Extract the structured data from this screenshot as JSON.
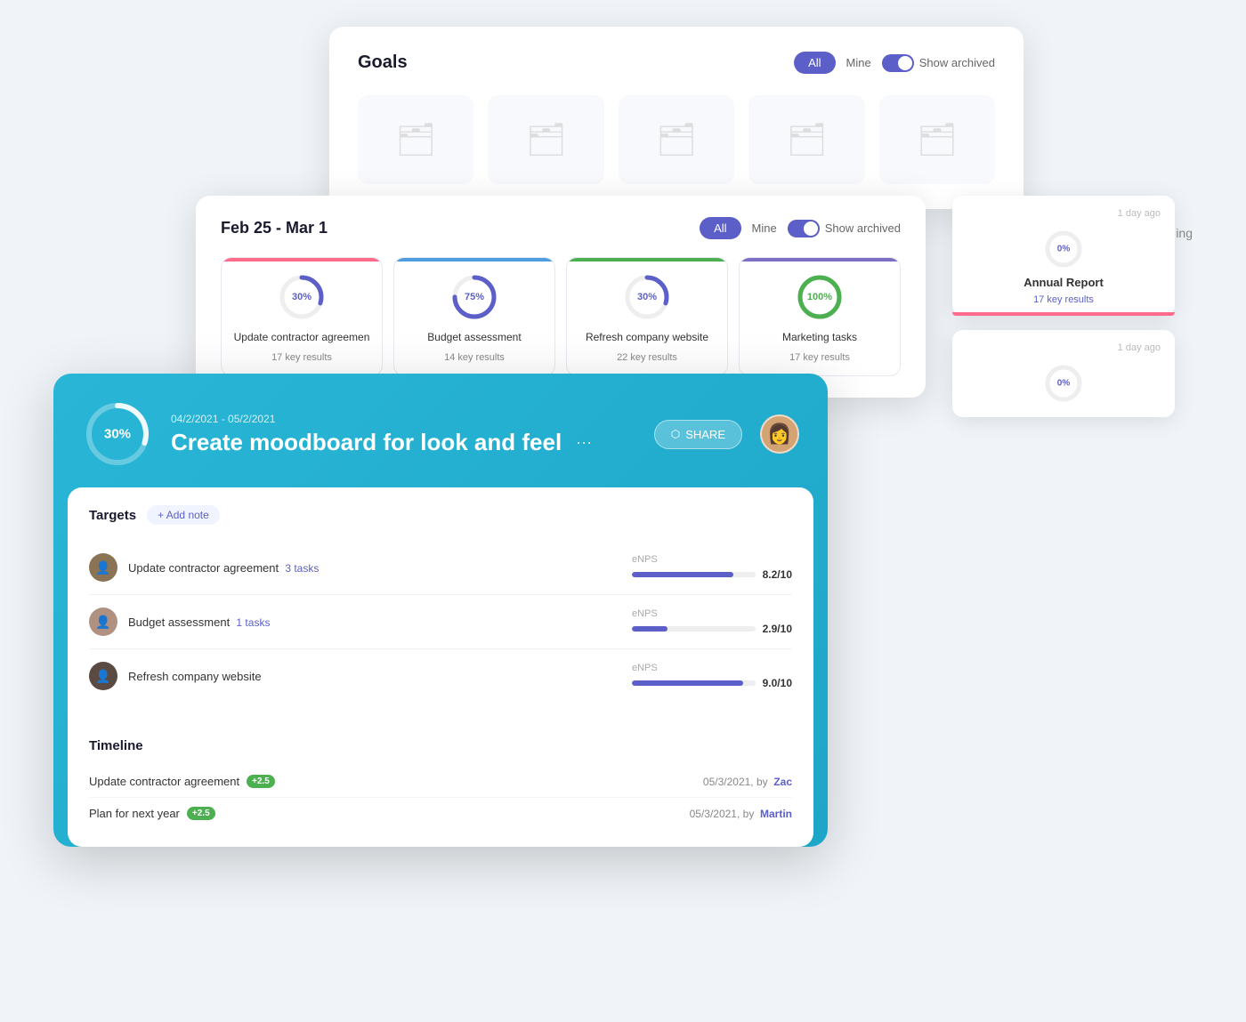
{
  "goals_panel": {
    "title": "Goals",
    "filter_all": "All",
    "filter_mine": "Mine",
    "toggle_label": "Show archived",
    "folders": [
      {
        "id": 1
      },
      {
        "id": 2
      },
      {
        "id": 3
      },
      {
        "id": 4
      },
      {
        "id": 5
      }
    ]
  },
  "weekly_panel": {
    "title": "Feb 25 - Mar 1",
    "filter_all": "All",
    "filter_mine": "Mine",
    "toggle_label": "Show archived",
    "goals": [
      {
        "name": "Update contractor agreemen",
        "results": "17 key results",
        "progress": 30,
        "color": "pink",
        "progress_color": "blue"
      },
      {
        "name": "Budget assessment",
        "results": "14 key results",
        "progress": 75,
        "color": "blue",
        "progress_color": "blue"
      },
      {
        "name": "Refresh company website",
        "results": "22 key results",
        "progress": 30,
        "color": "green",
        "progress_color": "blue"
      },
      {
        "name": "Marketing tasks",
        "results": "17 key results",
        "progress": 100,
        "color": "purple",
        "progress_color": "green"
      }
    ]
  },
  "right_cards": [
    {
      "time": "1 day ago",
      "name": "Annual Report",
      "results": "17 key results",
      "progress": 0,
      "bar_color": "pink"
    },
    {
      "time": "1 day ago",
      "name": "",
      "results": "",
      "progress": 0,
      "bar_color": "pink"
    }
  ],
  "main_panel": {
    "progress": 30,
    "date_range": "04/2/2021 - 05/2/2021",
    "title": "Create moodboard for look and feel",
    "share_label": "SHARE",
    "targets_title": "Targets",
    "add_note": "+ Add note",
    "targets": [
      {
        "name": "Update contractor agreement",
        "link_label": "3 tasks",
        "metric": "eNPS",
        "value": "8.2/10",
        "bar_pct": 82
      },
      {
        "name": "Budget assessment",
        "link_label": "1 tasks",
        "metric": "eNPS",
        "value": "2.9/10",
        "bar_pct": 29
      },
      {
        "name": "Refresh company website",
        "link_label": "",
        "metric": "eNPS",
        "value": "9.0/10",
        "bar_pct": 90
      }
    ],
    "timeline_title": "Timeline",
    "timeline_items": [
      {
        "name": "Update contractor agreement",
        "badge": "+2.5",
        "date": "05/3/2021, by",
        "author": "Zac"
      },
      {
        "name": "Plan for next year",
        "badge": "+2.5",
        "date": "05/3/2021, by",
        "author": "Martin"
      }
    ]
  },
  "partial_text": "ing"
}
